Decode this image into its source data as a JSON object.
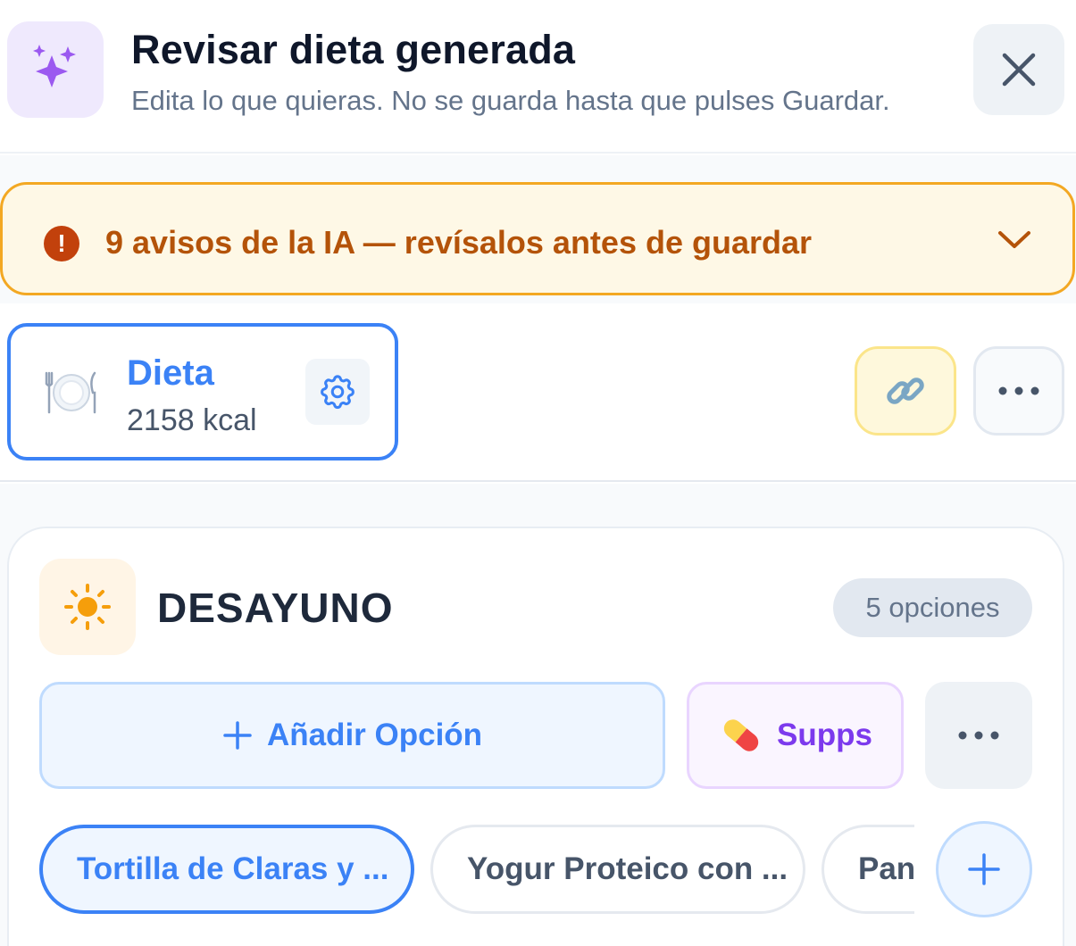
{
  "header": {
    "title": "Revisar dieta generada",
    "subtitle": "Edita lo que quieras. No se guarda hasta que pulses Guardar.",
    "icon": "sparkles-icon",
    "close_icon": "close-icon"
  },
  "warning": {
    "text": "9 avisos de la IA — revísalos antes de guardar",
    "icon_glyph": "!",
    "color": "#b45309"
  },
  "diet": {
    "name": "Dieta",
    "kcal": "2158 kcal",
    "accent": "#3b82f6"
  },
  "meal": {
    "title": "DESAYUNO",
    "options_badge": "5 opciones",
    "add_option_label": "Añadir Opción",
    "supps_label": "Supps",
    "options": [
      {
        "label": "Tortilla de Claras y ...",
        "active": true
      },
      {
        "label": "Yogur Proteico con ...",
        "active": false
      },
      {
        "label": "Pan",
        "active": false
      }
    ]
  }
}
